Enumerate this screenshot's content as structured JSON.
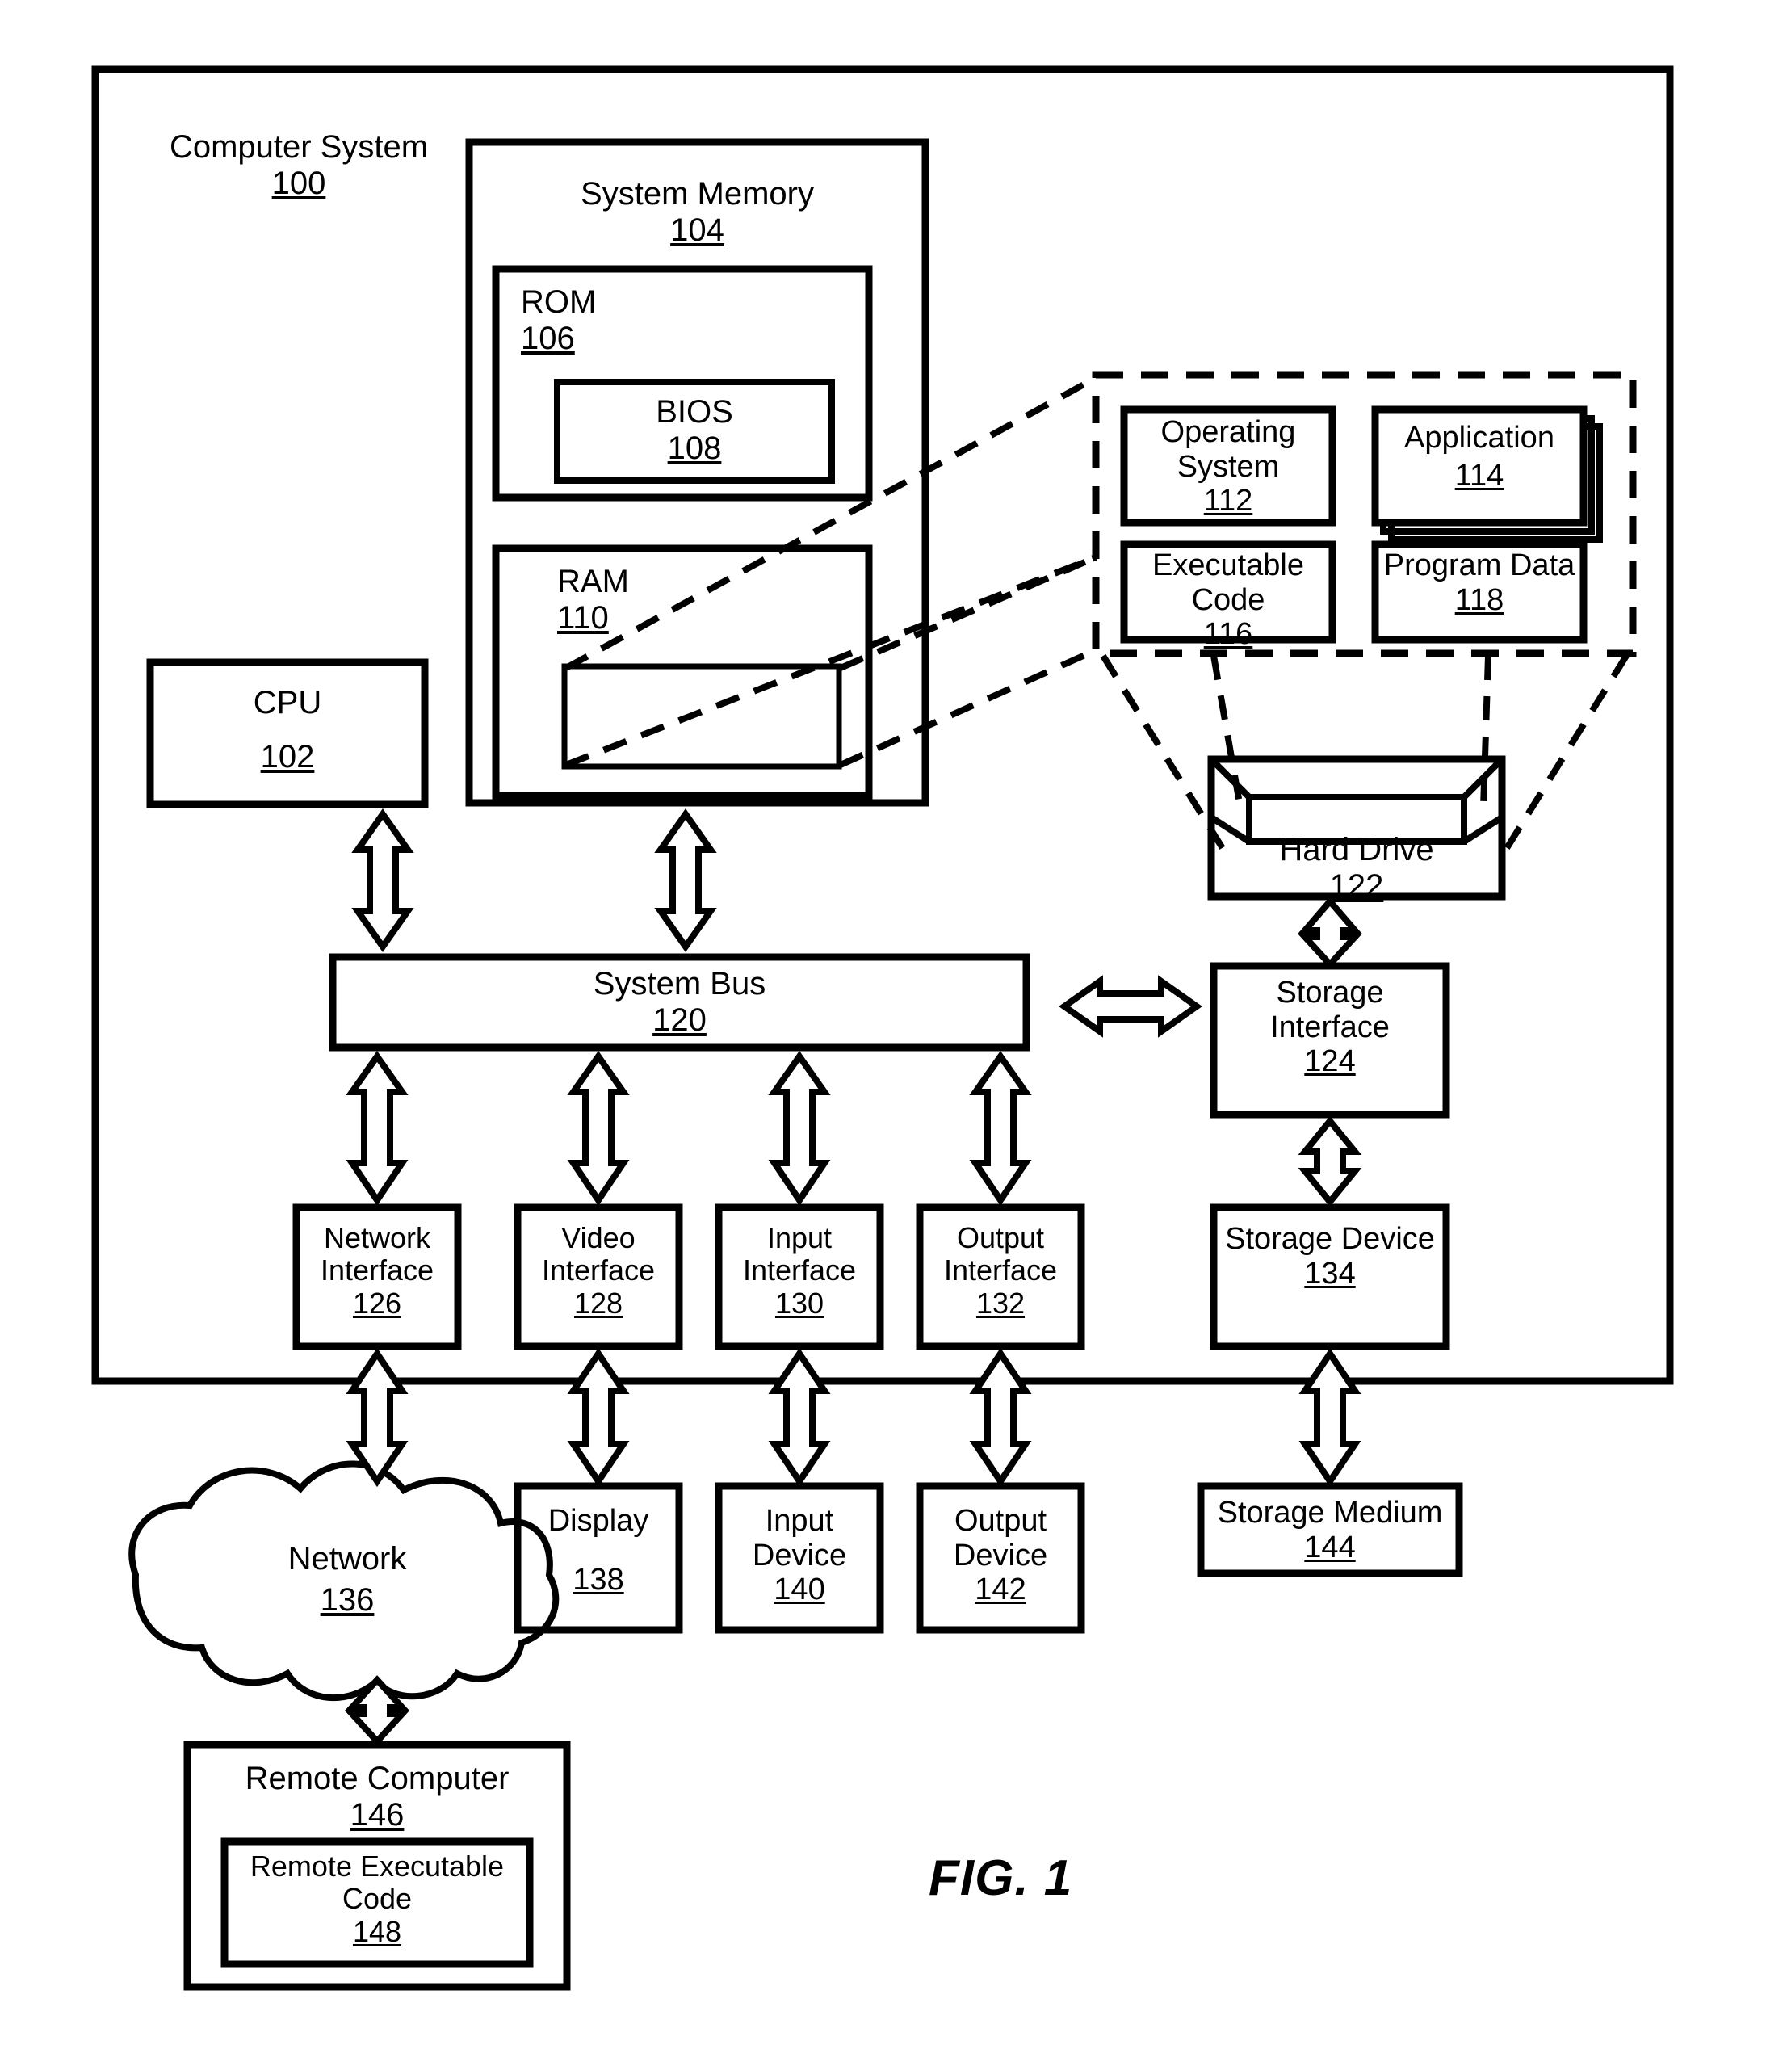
{
  "figure": {
    "caption": "FIG. 1"
  },
  "blocks": {
    "computer_system": {
      "title": "Computer System",
      "ref": "100"
    },
    "system_memory": {
      "title": "System Memory",
      "ref": "104"
    },
    "rom": {
      "title": "ROM",
      "ref": "106"
    },
    "bios": {
      "title": "BIOS",
      "ref": "108"
    },
    "ram": {
      "title": "RAM",
      "ref": "110"
    },
    "ram_inner": {
      "title": "",
      "ref": ""
    },
    "operating_system": {
      "title": "Operating System",
      "ref": "112"
    },
    "application": {
      "title": "Application",
      "ref": "114"
    },
    "executable_code": {
      "title": "Executable Code",
      "ref": "116"
    },
    "program_data": {
      "title": "Program Data",
      "ref": "118"
    },
    "cpu": {
      "title": "CPU",
      "ref": "102"
    },
    "system_bus": {
      "title": "System Bus",
      "ref": "120"
    },
    "hard_drive": {
      "title": "Hard Drive",
      "ref": "122"
    },
    "storage_interface": {
      "title": "Storage Interface",
      "ref": "124"
    },
    "network_interface": {
      "title": "Network Interface",
      "ref": "126"
    },
    "video_interface": {
      "title": "Video Interface",
      "ref": "128"
    },
    "input_interface": {
      "title": "Input Interface",
      "ref": "130"
    },
    "output_interface": {
      "title": "Output Interface",
      "ref": "132"
    },
    "storage_device": {
      "title": "Storage Device",
      "ref": "134"
    },
    "network": {
      "title": "Network",
      "ref": "136"
    },
    "display": {
      "title": "Display",
      "ref": "138"
    },
    "input_device": {
      "title": "Input Device",
      "ref": "140"
    },
    "output_device": {
      "title": "Output Device",
      "ref": "142"
    },
    "storage_medium": {
      "title": "Storage Medium",
      "ref": "144"
    },
    "remote_computer": {
      "title": "Remote Computer",
      "ref": "146"
    },
    "remote_executable_code": {
      "title": "Remote Executable Code",
      "ref": "148"
    }
  },
  "connectors": {
    "cpu_to_bus": "double-arrow-vertical",
    "memory_to_bus": "double-arrow-vertical",
    "bus_to_storage_interface": "double-arrow-horizontal",
    "harddrive_to_storage_interface": "double-arrow-vertical",
    "storage_interface_to_storage_device": "double-arrow-vertical",
    "storage_device_to_storage_medium": "double-arrow-vertical",
    "bus_to_network_interface": "double-arrow-vertical",
    "bus_to_video_interface": "double-arrow-vertical",
    "bus_to_input_interface": "double-arrow-vertical",
    "bus_to_output_interface": "double-arrow-vertical",
    "network_interface_to_network": "double-arrow-vertical",
    "video_interface_to_display": "double-arrow-vertical",
    "input_interface_to_input_device": "double-arrow-vertical",
    "output_interface_to_output_device": "double-arrow-vertical",
    "network_to_remote_computer": "double-arrow-vertical",
    "ram_to_contents": "dashed-callout",
    "harddrive_to_contents": "dashed-callout"
  },
  "colors": {
    "ink": "#000000",
    "paper": "#ffffff"
  }
}
